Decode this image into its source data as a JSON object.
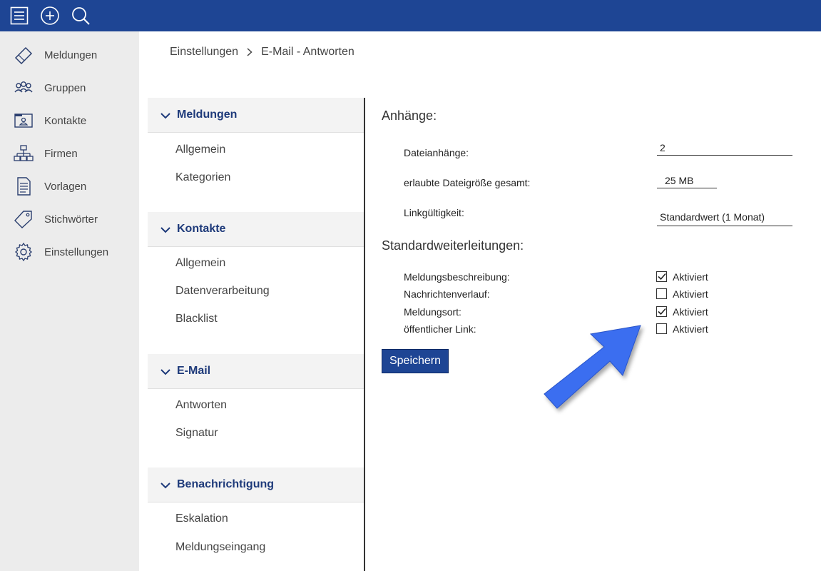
{
  "topbar": {
    "icons": [
      "hamburger-menu-icon",
      "add-circle-icon",
      "search-icon"
    ],
    "color": "#1e4594"
  },
  "leftnav": {
    "items": [
      {
        "label": "Meldungen",
        "icon": "ticket-icon"
      },
      {
        "label": "Gruppen",
        "icon": "group-icon"
      },
      {
        "label": "Kontakte",
        "icon": "contact-card-icon"
      },
      {
        "label": "Firmen",
        "icon": "org-chart-icon"
      },
      {
        "label": "Vorlagen",
        "icon": "document-icon"
      },
      {
        "label": "Stichwörter",
        "icon": "tag-icon"
      },
      {
        "label": "Einstellungen",
        "icon": "gear-icon"
      }
    ]
  },
  "breadcrumb": {
    "parent": "Einstellungen",
    "current": "E-Mail - Antworten"
  },
  "submenu": {
    "groups": [
      {
        "title": "Meldungen",
        "items": [
          "Allgemein",
          "Kategorien"
        ]
      },
      {
        "title": "Kontakte",
        "items": [
          "Allgemein",
          "Datenverarbeitung",
          "Blacklist"
        ]
      },
      {
        "title": "E-Mail",
        "items": [
          "Antworten",
          "Signatur"
        ]
      },
      {
        "title": "Benachrichtigung",
        "items": [
          "Eskalation",
          "Meldungseingang"
        ]
      }
    ]
  },
  "attachments": {
    "title": "Anhänge:",
    "fields": [
      {
        "label": "Dateianhänge:",
        "value": "2"
      },
      {
        "label": "erlaubte Dateigröße gesamt:",
        "value": "25 MB"
      },
      {
        "label": "Linkgültigkeit:",
        "value": "Standardwert (1 Monat)"
      }
    ]
  },
  "forwarding": {
    "title": "Standardweiterleitungen:",
    "rows": [
      {
        "label": "Meldungsbeschreibung:",
        "checked": true,
        "option": "Aktiviert"
      },
      {
        "label": "Nachrichtenverlauf:",
        "checked": false,
        "option": "Aktiviert"
      },
      {
        "label": "Meldungsort:",
        "checked": true,
        "option": "Aktiviert"
      },
      {
        "label": "öffentlicher Link:",
        "checked": false,
        "option": "Aktiviert"
      }
    ]
  },
  "save_label": "Speichern",
  "accent_color": "#3a6ef0"
}
